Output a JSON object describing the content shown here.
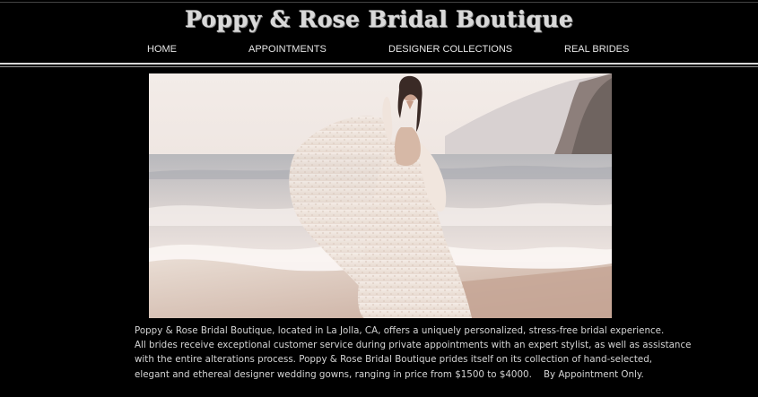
{
  "brand": {
    "title": "Poppy & Rose Bridal Boutique"
  },
  "nav": {
    "items": [
      {
        "label": "HOME"
      },
      {
        "label": "APPOINTMENTS"
      },
      {
        "label": "DESIGNER COLLECTIONS"
      },
      {
        "label": "REAL BRIDES"
      }
    ]
  },
  "hero": {
    "image": "bride-on-beach-photo"
  },
  "description": {
    "lines": [
      "Poppy & Rose Bridal Boutique, located in La Jolla, CA, offers a uniquely personalized, stress-free bridal experience.",
      "All brides receive exceptional customer service during private appointments with an expert stylist, as well as assistance",
      "with the entire alterations process. Poppy & Rose Bridal Boutique prides itself on its collection of hand-selected,",
      "elegant and ethereal designer wedding gowns, ranging in price from $1500 to $4000.    By Appointment Only."
    ]
  },
  "colors": {
    "background": "#000000",
    "text": "#d4d4d4",
    "rule": "#d8d8d8"
  }
}
